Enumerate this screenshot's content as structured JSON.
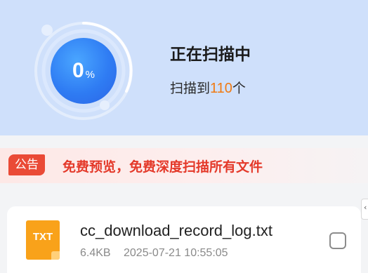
{
  "scan": {
    "percent": "0",
    "percent_unit": "%",
    "progress": 0,
    "title": "正在扫描中",
    "found_prefix": "扫描到",
    "found_count": "110",
    "found_suffix": "个"
  },
  "notice": {
    "tag": "公告",
    "text": "免费预览，免费深度扫描所有文件"
  },
  "files": [
    {
      "icon_label": "TXT",
      "name": "cc_download_record_log.txt",
      "size": "6.4KB",
      "date": "2025-07-21 10:55:05",
      "checked": false
    }
  ],
  "side_tab": {
    "glyph": "‹"
  },
  "colors": {
    "header_bg": "#cfe0fb",
    "gauge_blue": "#2f7cf3",
    "count_orange": "#f07a12",
    "notice_red": "#e4392a",
    "txt_icon": "#f9a21a"
  }
}
